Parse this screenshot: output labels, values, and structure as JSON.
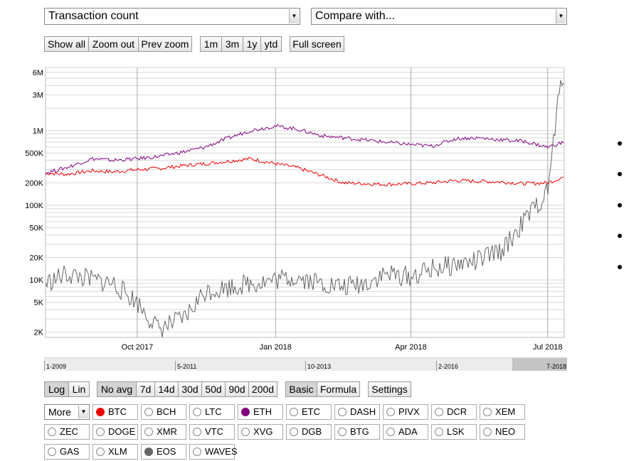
{
  "metric_select": {
    "value": "Transaction count"
  },
  "compare_select": {
    "value": "Compare with..."
  },
  "zoom_buttons": [
    "Show all",
    "Zoom out",
    "Prev zoom"
  ],
  "range_buttons": [
    "1m",
    "3m",
    "1y",
    "ytd"
  ],
  "fullscreen_label": "Full screen",
  "scale_buttons": [
    {
      "label": "Log",
      "active": true
    },
    {
      "label": "Lin",
      "active": false
    }
  ],
  "avg_buttons": [
    {
      "label": "No avg",
      "active": true
    },
    {
      "label": "7d",
      "active": false
    },
    {
      "label": "14d",
      "active": false
    },
    {
      "label": "30d",
      "active": false
    },
    {
      "label": "50d",
      "active": false
    },
    {
      "label": "90d",
      "active": false
    },
    {
      "label": "200d",
      "active": false
    }
  ],
  "mode_buttons": [
    {
      "label": "Basic",
      "active": true
    },
    {
      "label": "Formula",
      "active": false
    }
  ],
  "settings_label": "Settings",
  "more_select": {
    "value": "More"
  },
  "coins": [
    {
      "name": "BTC",
      "color": "#ee0000",
      "selected": true
    },
    {
      "name": "BCH",
      "selected": false
    },
    {
      "name": "LTC",
      "selected": false
    },
    {
      "name": "ETH",
      "color": "#800080",
      "selected": true
    },
    {
      "name": "ETC",
      "selected": false
    },
    {
      "name": "DASH",
      "selected": false
    },
    {
      "name": "PIVX",
      "selected": false
    },
    {
      "name": "DCR",
      "selected": false
    },
    {
      "name": "XEM",
      "selected": false
    },
    {
      "name": "ZEC",
      "selected": false
    },
    {
      "name": "DOGE",
      "selected": false
    },
    {
      "name": "XMR",
      "selected": false
    },
    {
      "name": "VTC",
      "selected": false
    },
    {
      "name": "XVG",
      "selected": false
    },
    {
      "name": "DGB",
      "selected": false
    },
    {
      "name": "BTG",
      "selected": false
    },
    {
      "name": "ADA",
      "selected": false
    },
    {
      "name": "LSK",
      "selected": false
    },
    {
      "name": "NEO",
      "selected": false
    },
    {
      "name": "GAS",
      "selected": false
    },
    {
      "name": "XLM",
      "selected": false
    },
    {
      "name": "EOS",
      "color": "#666666",
      "selected": true
    },
    {
      "name": "WAVES",
      "selected": false
    }
  ],
  "navigator_labels": [
    "1-2009",
    "5-2011",
    "10-2013",
    "2-2016",
    "7-2018"
  ],
  "chart_data": {
    "type": "line",
    "y_scale": "log",
    "ylim": [
      1700,
      7000000
    ],
    "x_range": [
      "2017-08-01",
      "2018-07-12"
    ],
    "y_ticks": [
      {
        "label": "2K",
        "value": 2000
      },
      {
        "label": "5K",
        "value": 5000
      },
      {
        "label": "10K",
        "value": 10000
      },
      {
        "label": "20K",
        "value": 20000
      },
      {
        "label": "50K",
        "value": 50000
      },
      {
        "label": "100K",
        "value": 100000
      },
      {
        "label": "200K",
        "value": 200000
      },
      {
        "label": "500K",
        "value": 500000
      },
      {
        "label": "1M",
        "value": 1000000
      },
      {
        "label": "3M",
        "value": 3000000
      },
      {
        "label": "6M",
        "value": 6000000
      }
    ],
    "x_ticks": [
      {
        "label": "Oct 2017",
        "date": "2017-10-01"
      },
      {
        "label": "Jan 2018",
        "date": "2018-01-01"
      },
      {
        "label": "Apr 2018",
        "date": "2018-04-01"
      },
      {
        "label": "Jul 2018",
        "date": "2018-07-01"
      }
    ],
    "grid": true,
    "series": [
      {
        "color": "#ee0000",
        "points": [
          [
            "2017-08-01",
            270000
          ],
          [
            "2017-08-15",
            260000
          ],
          [
            "2017-09-01",
            290000
          ],
          [
            "2017-09-15",
            280000
          ],
          [
            "2017-10-01",
            300000
          ],
          [
            "2017-10-15",
            310000
          ],
          [
            "2017-11-01",
            340000
          ],
          [
            "2017-11-15",
            360000
          ],
          [
            "2017-12-01",
            390000
          ],
          [
            "2017-12-15",
            420000
          ],
          [
            "2018-01-01",
            360000
          ],
          [
            "2018-01-15",
            320000
          ],
          [
            "2018-02-01",
            250000
          ],
          [
            "2018-02-15",
            200000
          ],
          [
            "2018-03-01",
            195000
          ],
          [
            "2018-03-15",
            190000
          ],
          [
            "2018-04-01",
            195000
          ],
          [
            "2018-04-15",
            200000
          ],
          [
            "2018-05-01",
            215000
          ],
          [
            "2018-05-15",
            210000
          ],
          [
            "2018-06-01",
            205000
          ],
          [
            "2018-06-15",
            195000
          ],
          [
            "2018-07-01",
            200000
          ],
          [
            "2018-07-12",
            240000
          ]
        ]
      },
      {
        "color": "#800080",
        "points": [
          [
            "2017-08-01",
            270000
          ],
          [
            "2017-08-15",
            320000
          ],
          [
            "2017-09-01",
            420000
          ],
          [
            "2017-09-15",
            400000
          ],
          [
            "2017-10-01",
            420000
          ],
          [
            "2017-10-15",
            450000
          ],
          [
            "2017-11-01",
            520000
          ],
          [
            "2017-11-15",
            600000
          ],
          [
            "2017-12-01",
            800000
          ],
          [
            "2017-12-15",
            1000000
          ],
          [
            "2018-01-01",
            1150000
          ],
          [
            "2018-01-15",
            1050000
          ],
          [
            "2018-02-01",
            850000
          ],
          [
            "2018-02-15",
            800000
          ],
          [
            "2018-03-01",
            750000
          ],
          [
            "2018-03-15",
            700000
          ],
          [
            "2018-04-01",
            650000
          ],
          [
            "2018-04-15",
            620000
          ],
          [
            "2018-05-01",
            780000
          ],
          [
            "2018-05-15",
            800000
          ],
          [
            "2018-06-01",
            750000
          ],
          [
            "2018-06-15",
            720000
          ],
          [
            "2018-07-01",
            600000
          ],
          [
            "2018-07-12",
            700000
          ]
        ]
      },
      {
        "color": "#666666",
        "points": [
          [
            "2017-08-01",
            9000
          ],
          [
            "2017-08-15",
            12000
          ],
          [
            "2017-09-01",
            10000
          ],
          [
            "2017-09-15",
            9000
          ],
          [
            "2017-10-01",
            5000
          ],
          [
            "2017-10-15",
            2200
          ],
          [
            "2017-11-01",
            3000
          ],
          [
            "2017-11-15",
            7000
          ],
          [
            "2017-12-01",
            8000
          ],
          [
            "2017-12-15",
            9000
          ],
          [
            "2018-01-01",
            10000
          ],
          [
            "2018-01-15",
            11000
          ],
          [
            "2018-02-01",
            9000
          ],
          [
            "2018-02-15",
            8000
          ],
          [
            "2018-03-01",
            9000
          ],
          [
            "2018-03-15",
            12000
          ],
          [
            "2018-04-01",
            11000
          ],
          [
            "2018-04-15",
            14000
          ],
          [
            "2018-05-01",
            16000
          ],
          [
            "2018-05-15",
            18000
          ],
          [
            "2018-06-01",
            25000
          ],
          [
            "2018-06-15",
            60000
          ],
          [
            "2018-07-01",
            150000
          ],
          [
            "2018-07-08",
            2500000
          ],
          [
            "2018-07-12",
            6500000
          ]
        ]
      }
    ]
  }
}
